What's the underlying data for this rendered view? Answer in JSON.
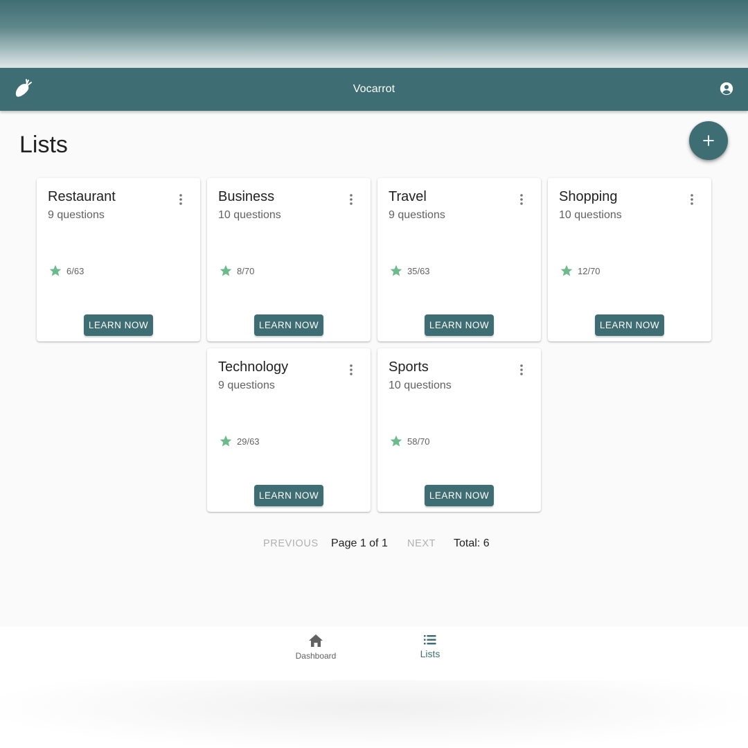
{
  "app": {
    "title": "Vocarrot",
    "primary_color": "#3e6e73",
    "accent_star_color": "#6dbb8a",
    "logo_icon": "carrot-icon",
    "account_icon": "account-circle-icon"
  },
  "page": {
    "title": "Lists",
    "fab_icon": "plus-icon"
  },
  "lists": [
    {
      "name": "Restaurant",
      "questions": "9 questions",
      "score": "6/63",
      "button": "LEARN NOW"
    },
    {
      "name": "Business",
      "questions": "10 questions",
      "score": "8/70",
      "button": "LEARN NOW"
    },
    {
      "name": "Travel",
      "questions": "9 questions",
      "score": "35/63",
      "button": "LEARN NOW"
    },
    {
      "name": "Shopping",
      "questions": "10 questions",
      "score": "12/70",
      "button": "LEARN NOW"
    },
    {
      "name": "Technology",
      "questions": "9 questions",
      "score": "29/63",
      "button": "LEARN NOW"
    },
    {
      "name": "Sports",
      "questions": "10 questions",
      "score": "58/70",
      "button": "LEARN NOW"
    }
  ],
  "pagination": {
    "previous": "PREVIOUS",
    "page_info": "Page 1 of 1",
    "next": "NEXT",
    "total": "Total: 6"
  },
  "bottom_nav": {
    "items": [
      {
        "label": "Dashboard",
        "icon": "home-icon",
        "active": false
      },
      {
        "label": "Lists",
        "icon": "list-icon",
        "active": true
      }
    ]
  }
}
